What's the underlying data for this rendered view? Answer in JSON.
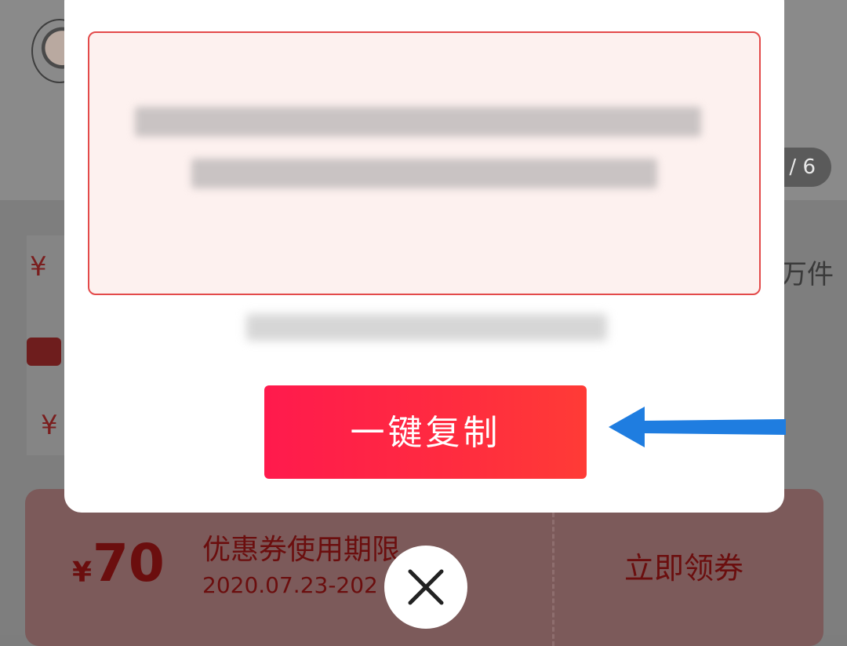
{
  "background": {
    "image_counter": "/ 6",
    "sales_suffix": "万件"
  },
  "modal": {
    "copy_button_label": "一键复制",
    "close_icon": "close-icon",
    "arrow_icon": "arrow-left-icon"
  },
  "coupon": {
    "currency": "¥",
    "amount": "70",
    "title": "优惠券使用期限",
    "date_range": "2020.07.23-202",
    "action": "立即领券"
  },
  "colors": {
    "accent_red": "#ff2c3f",
    "arrow_blue": "#1f7de0"
  }
}
